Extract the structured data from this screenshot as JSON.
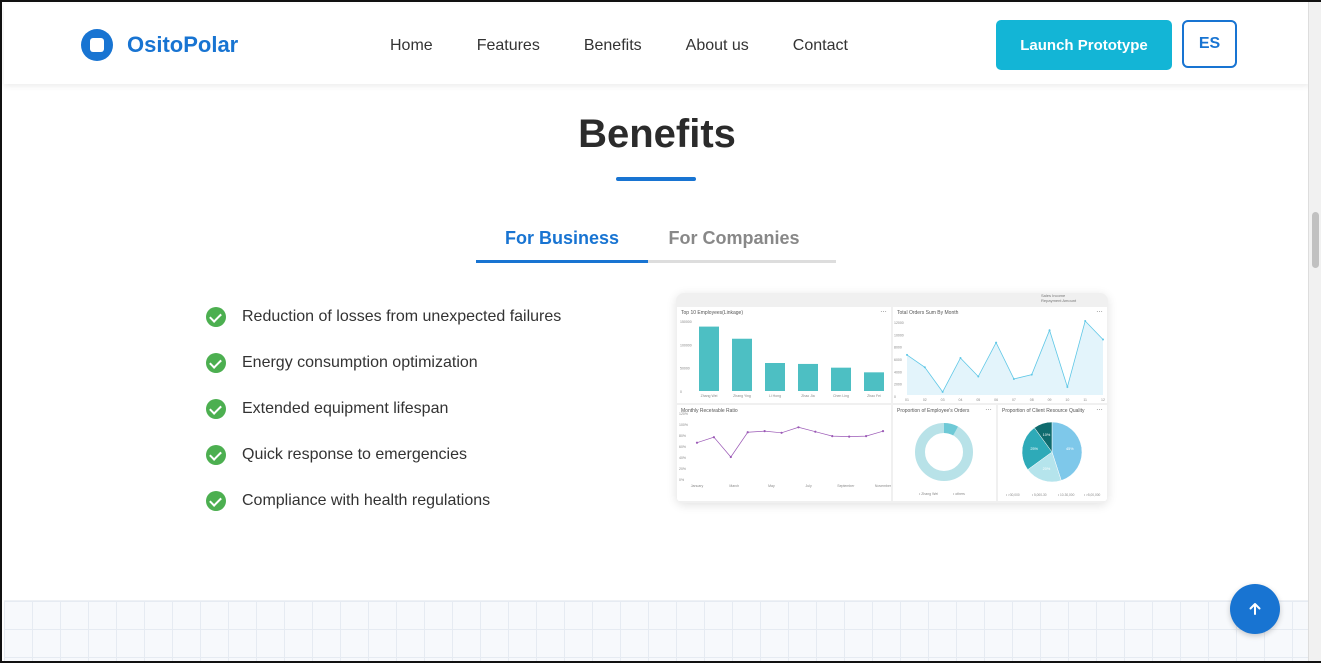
{
  "header": {
    "logo_text": "OsitoPolar",
    "nav": [
      "Home",
      "Features",
      "Benefits",
      "About us",
      "Contact"
    ],
    "launch_label": "Launch Prototype",
    "lang_label": "ES"
  },
  "benefits": {
    "title": "Benefits",
    "tabs": [
      {
        "label": "For Business",
        "active": true
      },
      {
        "label": "For Companies",
        "active": false
      }
    ],
    "items": [
      "Reduction of losses from unexpected failures",
      "Energy consumption optimization",
      "Extended equipment lifespan",
      "Quick response to emergencies",
      "Compliance with health regulations"
    ]
  },
  "dashboard": {
    "legend": [
      "Sales Income",
      "Repayment Amount"
    ],
    "bar_panel": {
      "title": "Top 10 Employees(Linkage)",
      "ticks": [
        "150000",
        "100000",
        "50000",
        "0"
      ],
      "categories": [
        "Zhang Wei",
        "Zhang Ying",
        "Li Hong",
        "Zhao Jia",
        "Chen Ling",
        "Zhao Fei"
      ],
      "values": [
        138000,
        112000,
        60000,
        58000,
        50000,
        40000
      ]
    },
    "line_panel": {
      "title": "Total Orders Sum By Month",
      "ticks": [
        "12000",
        "10000",
        "8000",
        "6000",
        "4000",
        "2000",
        "0"
      ],
      "months": [
        "01",
        "02",
        "03",
        "04",
        "05",
        "06",
        "07",
        "08",
        "09",
        "10",
        "11",
        "12"
      ],
      "values": [
        6500,
        4500,
        500,
        6000,
        3000,
        8500,
        2600,
        3300,
        10500,
        1300,
        12000,
        9000
      ]
    },
    "ratio_panel": {
      "title": "Monthly Receivable Ratio",
      "ticks": [
        "120%",
        "100%",
        "80%",
        "60%",
        "40%",
        "20%",
        "0%"
      ],
      "months": [
        "January",
        "March",
        "May",
        "July",
        "September",
        "November"
      ],
      "values": [
        66,
        76,
        40,
        85,
        87,
        84,
        94,
        86,
        78,
        77,
        78,
        87
      ]
    },
    "donut_panel": {
      "title": "Proportion of Employee's Orders",
      "legend": [
        "Zhang Wei",
        "others"
      ],
      "values": [
        8,
        92
      ]
    },
    "pie_panel": {
      "title": "Proportion of Client Resource Quality",
      "legend": [
        ">30,000",
        "5,000-30",
        "10-30,000",
        ">5,00,000"
      ],
      "slices": [
        {
          "label": "45%",
          "value": 45
        },
        {
          "label": "20%",
          "value": 20
        },
        {
          "label": "25%",
          "value": 25
        },
        {
          "label": "10%",
          "value": 10
        }
      ]
    }
  },
  "colors": {
    "brand": "#1874d2",
    "accent": "#13b5d6",
    "check": "#4caf50",
    "bar": "#4dbfc3",
    "line_accent": "#9b59b6"
  },
  "icons": {
    "back_to_top": "arrow-up-icon"
  }
}
